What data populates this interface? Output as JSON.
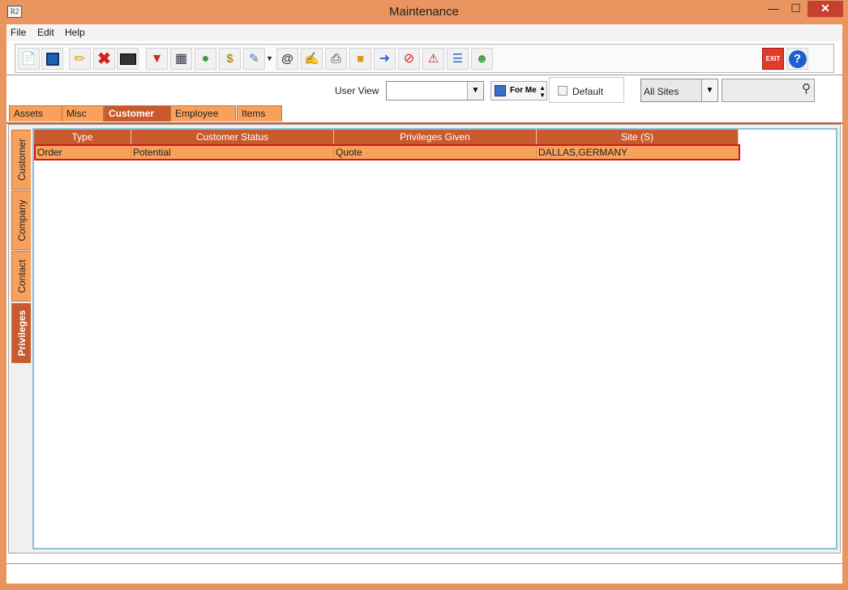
{
  "window": {
    "title": "Maintenance",
    "app_icon_label": "R2"
  },
  "menu": [
    "File",
    "Edit",
    "Help"
  ],
  "toolbar": {
    "left_icons": [
      "new-document-icon",
      "save-icon",
      "edit-pencil-icon",
      "delete-icon",
      "keyboard-icon",
      "filter-icon",
      "grid-icon",
      "users-icon",
      "money-bag-icon",
      "notes-icon",
      "email-icon",
      "form-edit-icon",
      "print-icon",
      "package-icon",
      "transfer-icon",
      "cancel-icon",
      "alert-message-icon",
      "search-report-icon",
      "worker-icon"
    ],
    "right_icons": [
      "exit-icon",
      "help-icon"
    ],
    "exit_label": "EXIT"
  },
  "filter": {
    "user_view_label": "User View",
    "user_view_value": "",
    "for_me_label": "For Me",
    "default_label": "Default",
    "sites_value": "All Sites",
    "search_value": ""
  },
  "tabs": [
    {
      "label": "Assets",
      "active": false
    },
    {
      "label": "Misc",
      "active": false
    },
    {
      "label": "Customer",
      "active": true
    },
    {
      "label": "Employee",
      "active": false
    },
    {
      "label": "Items",
      "active": false
    }
  ],
  "side_tabs": [
    {
      "label": "Customer",
      "active": false
    },
    {
      "label": "Company",
      "active": false
    },
    {
      "label": "Contact",
      "active": false
    },
    {
      "label": "Privileges",
      "active": true
    }
  ],
  "table": {
    "columns": [
      "Type",
      "Customer Status",
      "Privileges Given",
      "Site (S)"
    ],
    "rows": [
      [
        "Order",
        "Potential",
        "Quote",
        "DALLAS,GERMANY"
      ]
    ]
  }
}
